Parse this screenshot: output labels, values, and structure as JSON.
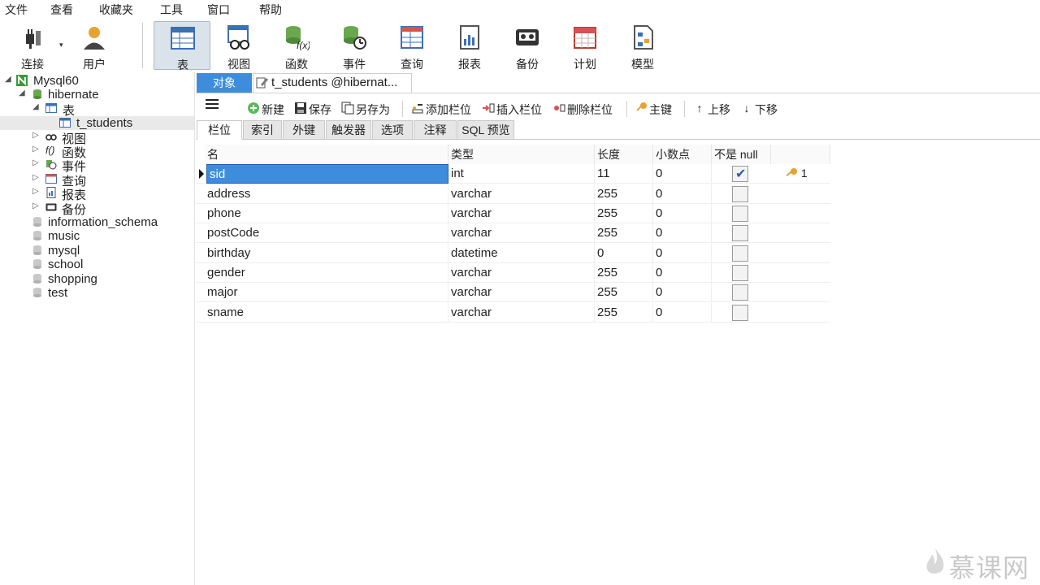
{
  "menu": [
    "文件",
    "查看",
    "收藏夹",
    "工具",
    "窗口",
    "帮助"
  ],
  "toolbar": {
    "connect": "连接",
    "user": "用户",
    "table": "表",
    "view": "视图",
    "function": "函数",
    "event": "事件",
    "query": "查询",
    "report": "报表",
    "backup": "备份",
    "schedule": "计划",
    "model": "模型"
  },
  "tree": {
    "connection": "Mysql60",
    "database": "hibernate",
    "tables_group": "表",
    "table": "t_students",
    "views": "视图",
    "functions": "函数",
    "events": "事件",
    "queries": "查询",
    "reports": "报表",
    "backups": "备份",
    "other_dbs": [
      "information_schema",
      "music",
      "mysql",
      "school",
      "shopping",
      "test"
    ]
  },
  "object_tabs": {
    "objects": "对象",
    "doc": "t_students @hibernat..."
  },
  "design_toolbar": {
    "new": "新建",
    "save": "保存",
    "save_as": "另存为",
    "add_field": "添加栏位",
    "insert_field": "插入栏位",
    "delete_field": "删除栏位",
    "primary_key": "主键",
    "move_up": "上移",
    "move_down": "下移"
  },
  "sub_tabs": [
    "栏位",
    "索引",
    "外键",
    "触发器",
    "选项",
    "注释",
    "SQL 预览"
  ],
  "grid": {
    "headers": [
      "名",
      "类型",
      "长度",
      "小数点",
      "不是 null"
    ],
    "rows": [
      {
        "name": "sid",
        "type": "int",
        "length": "11",
        "decimals": "0",
        "not_null": true,
        "key": "1"
      },
      {
        "name": "address",
        "type": "varchar",
        "length": "255",
        "decimals": "0",
        "not_null": false,
        "key": ""
      },
      {
        "name": "phone",
        "type": "varchar",
        "length": "255",
        "decimals": "0",
        "not_null": false,
        "key": ""
      },
      {
        "name": "postCode",
        "type": "varchar",
        "length": "255",
        "decimals": "0",
        "not_null": false,
        "key": ""
      },
      {
        "name": "birthday",
        "type": "datetime",
        "length": "0",
        "decimals": "0",
        "not_null": false,
        "key": ""
      },
      {
        "name": "gender",
        "type": "varchar",
        "length": "255",
        "decimals": "0",
        "not_null": false,
        "key": ""
      },
      {
        "name": "major",
        "type": "varchar",
        "length": "255",
        "decimals": "0",
        "not_null": false,
        "key": ""
      },
      {
        "name": "sname",
        "type": "varchar",
        "length": "255",
        "decimals": "0",
        "not_null": false,
        "key": ""
      }
    ]
  },
  "watermark": "慕课网",
  "colors": {
    "accent": "#3e8ddd",
    "active_tool": "#dbe3ea"
  }
}
